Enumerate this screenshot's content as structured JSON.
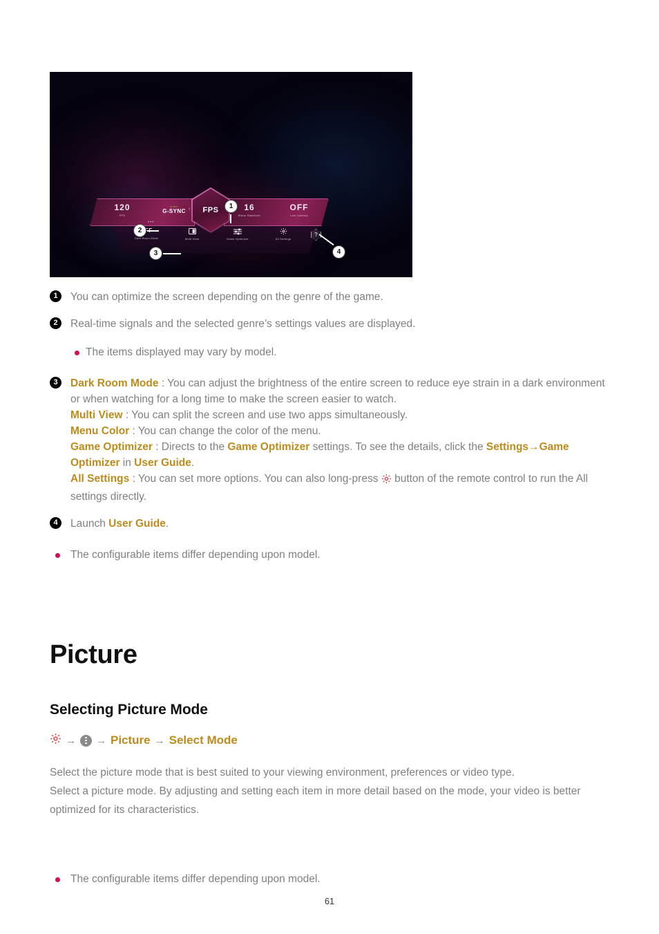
{
  "figure": {
    "alt_name": "game-optimizer-game-bar-screenshot",
    "gamebar": {
      "left_panel": [
        {
          "value": "120",
          "label": "FPS"
        }
      ],
      "gsync": {
        "top": "NVIDIA",
        "main": "G-SYNC"
      },
      "center_hex": "FPS",
      "left_arrow": "‹",
      "right_arrow": "›",
      "right_panel": [
        {
          "value": "16",
          "label": "Black Stabilizer"
        },
        {
          "value": "OFF",
          "label": "Low Latency"
        }
      ],
      "dots": "•••",
      "bottom_items": [
        {
          "value": "OFF",
          "icon": "",
          "label": "Dark Room Mode"
        },
        {
          "value": "",
          "icon": "multi-view-icon",
          "label": "Multi View"
        },
        {
          "value": "",
          "icon": "sliders-icon",
          "label": "Game Optimizer"
        },
        {
          "value": "",
          "icon": "gear-icon",
          "label": "All Settings"
        }
      ],
      "help_hex": "?"
    },
    "callouts": [
      "1",
      "2",
      "3",
      "4"
    ]
  },
  "notes": {
    "item1": {
      "badge": "1",
      "text": "You can optimize the screen depending on the genre of the game."
    },
    "item2": {
      "badge": "2",
      "text": "Real-time signals and the selected genre’s settings values are displayed."
    },
    "item2_sub": "The items displayed may vary by model.",
    "item3": {
      "badge": "3",
      "dark_room_mode_label": "Dark Room Mode",
      "dark_room_mode_text": " : You can adjust the brightness of the entire screen to reduce eye strain in a dark environment or when watching for a long time to make the screen easier to watch.",
      "multi_view_label": "Multi View",
      "multi_view_text": " : You can split the screen and use two apps simultaneously.",
      "menu_color_label": "Menu Color",
      "menu_color_text": " : You can change the color of the menu.",
      "game_optimizer_label": "Game Optimizer",
      "game_optimizer_text_a": " : Directs to the ",
      "game_optimizer_link": "Game Optimizer",
      "game_optimizer_text_b": " settings. To see the details, click the ",
      "settings_link": "Settings",
      "path_arrow": "→",
      "game_optimizer_link2": "Game Optimizer",
      "in_word": " in ",
      "user_guide_link": "User Guide",
      "period": ".",
      "all_settings_label": "All Settings",
      "all_settings_text_a": " : You can set more options. You can also long-press ",
      "all_settings_icon": "gear-icon",
      "all_settings_text_b": " button of the remote control to run the All settings directly."
    },
    "item4": {
      "badge": "4",
      "prefix": "Launch ",
      "link": "User Guide",
      "suffix": "."
    },
    "page_note": "The configurable items differ depending upon model."
  },
  "picture_section": {
    "title": "Picture",
    "subhead": "Selecting Picture Mode",
    "breadcrumb": {
      "gear_icon": "gear-icon",
      "arrow1": "→",
      "dots_icon": "more-options-icon",
      "arrow2": "→",
      "picture": "Picture",
      "arrow3": "→",
      "select_mode": "Select Mode"
    },
    "paragraph1": "Select the picture mode that is best suited to your viewing environment, preferences or video type.",
    "paragraph2": "Select a picture mode. By adjusting and setting each item in more detail based on the mode, your video is better optimized for its characteristics.",
    "bullet": "The configurable items differ depending upon model."
  },
  "footer": {
    "page_number": "61"
  },
  "colors": {
    "gold": "#bf8b1c",
    "body_gray": "#808080",
    "bullet_pink": "#cf1058",
    "gear_red": "#e03b3b",
    "heading_black": "#111111"
  }
}
